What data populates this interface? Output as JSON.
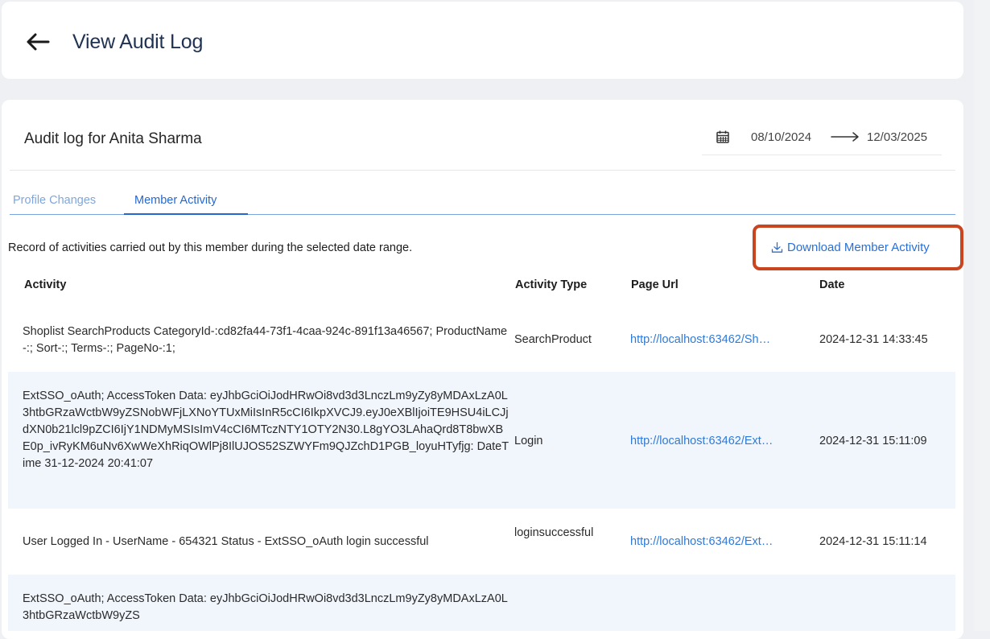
{
  "header": {
    "title": "View Audit Log",
    "back_icon": "arrow-left-icon"
  },
  "audit": {
    "heading": "Audit log for Anita Sharma",
    "date_start": "08/10/2024",
    "date_end": "12/03/2025",
    "calendar_icon": "calendar-icon",
    "range_arrow_icon": "long-arrow-right-icon"
  },
  "tabs": [
    {
      "label": "Profile Changes",
      "active": false
    },
    {
      "label": "Member Activity",
      "active": true
    }
  ],
  "description": "Record of activities carried out by this member during the selected date range.",
  "download": {
    "label": "Download Member Activity",
    "icon": "download-icon"
  },
  "table": {
    "columns": [
      "Activity",
      "Activity Type",
      "Page Url",
      "Date"
    ],
    "rows": [
      {
        "activity": "Shoplist SearchProducts CategoryId-:cd82fa44-73f1-4caa-924c-891f13a46567; ProductName-:; Sort-:; Terms-:; PageNo-:1;",
        "type": "SearchProduct",
        "url": "http://localhost:63462/Sh…",
        "date": "2024-12-31 14:33:45"
      },
      {
        "activity": "ExtSSO_oAuth; AccessToken Data: eyJhbGciOiJodHRwOi8vd3d3LnczLm9yZy8yMDAxLzA0L3htbGRzaWctbW9yZSNobWFjLXNoYTUxMiIsInR5cCI6IkpXVCJ9.eyJ0eXBlIjoiTE9HSU4iLCJjdXN0b21lcl9pZCI6IjY1NDMyMSIsImV4cCI6MTczNTY1OTY2N30.L8gYO3LAhaQrd8T8bwXBE0p_ivRyKM6uNv6XwWeXhRiqOWlPj8IlUJOS52SZWYFm9QJZchD1PGB_loyuHTyfjg: DateTime 31-12-2024 20:41:07",
        "type": "Login",
        "url": "http://localhost:63462/Ext…",
        "date": "2024-12-31 15:11:09"
      },
      {
        "activity": "User Logged In - UserName - 654321 Status - ExtSSO_oAuth login successful",
        "type": "loginsuccessful",
        "url": "http://localhost:63462/Ext…",
        "date": "2024-12-31 15:11:14"
      },
      {
        "activity": "ExtSSO_oAuth; AccessToken Data: eyJhbGciOiJodHRwOi8vd3d3LnczLm9yZy8yMDAxLzA0L3htbGRzaWctbW9yZS",
        "type": "",
        "url": "",
        "date": ""
      }
    ]
  },
  "colors": {
    "title": "#1f3252",
    "link": "#2f7ad6",
    "active_tab": "#2567d0",
    "highlight_border": "#c9451f",
    "row_alt": "#f1f6fd"
  }
}
